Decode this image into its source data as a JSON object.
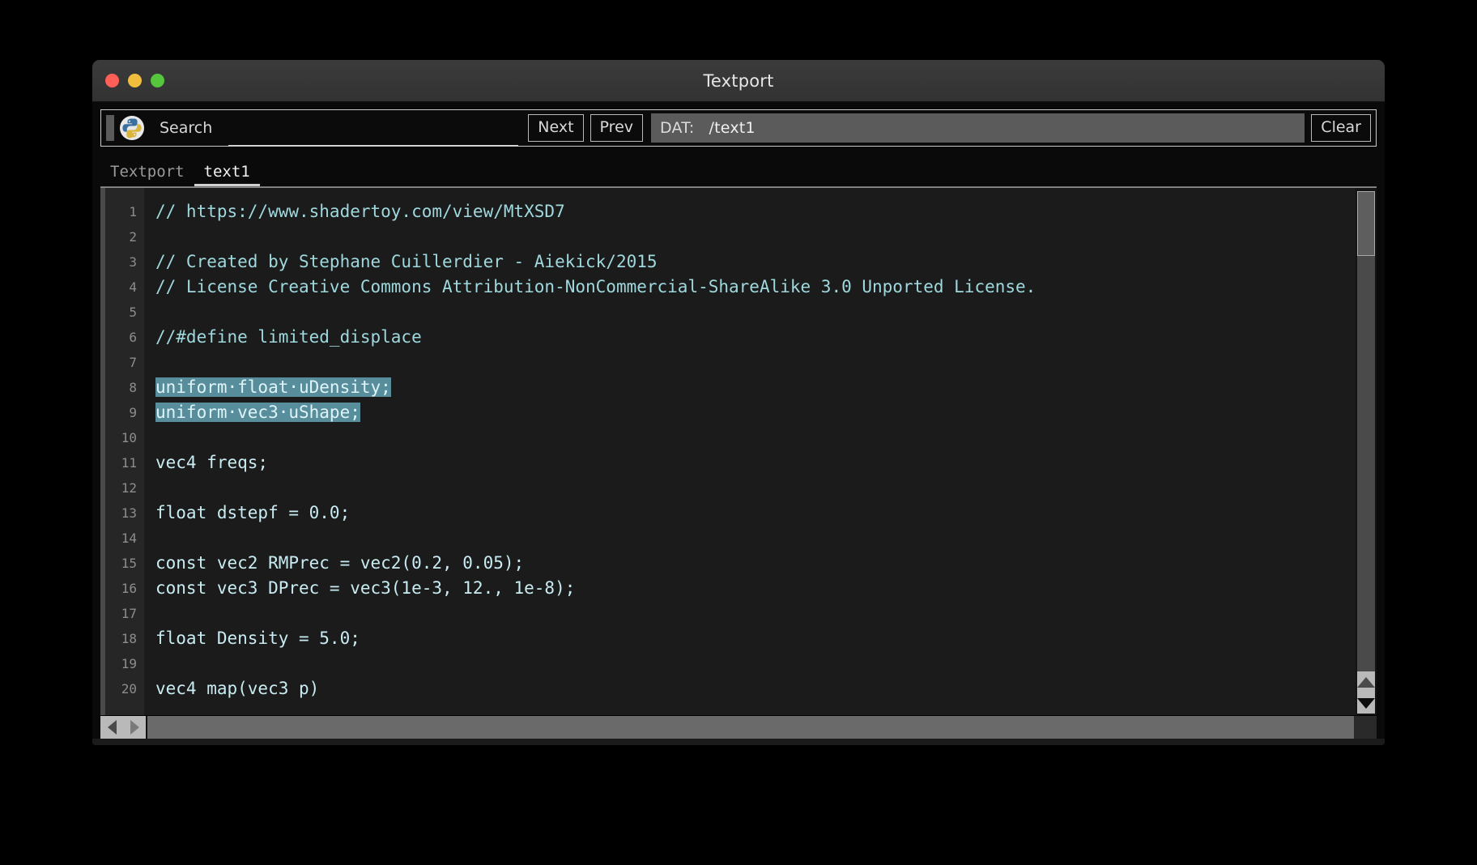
{
  "window": {
    "title": "Textport",
    "traffic_lights": [
      {
        "name": "close",
        "color": "#ff5f57"
      },
      {
        "name": "minimize",
        "color": "#f0bd3f"
      },
      {
        "name": "maximize",
        "color": "#56c73d"
      }
    ]
  },
  "toolbar": {
    "python_icon": "python-logo-icon",
    "search_label": "Search",
    "search_value": "",
    "search_placeholder": "",
    "next_label": "Next",
    "prev_label": "Prev",
    "dat_label": "DAT:",
    "dat_value": "/text1",
    "clear_label": "Clear"
  },
  "tabs": [
    {
      "label": "Textport",
      "active": false
    },
    {
      "label": "text1",
      "active": true
    }
  ],
  "editor": {
    "language": "glsl",
    "selection_color": "#588e9c",
    "comment_color": "#9fd8dd",
    "code_color": "#c8ecf2",
    "lines": [
      {
        "n": "1",
        "text": "// https://www.shadertoy.com/view/MtXSD7",
        "kind": "comment",
        "selected": false
      },
      {
        "n": "2",
        "text": "",
        "kind": "blank",
        "selected": false
      },
      {
        "n": "3",
        "text": "// Created by Stephane Cuillerdier - Aiekick/2015",
        "kind": "comment",
        "selected": false
      },
      {
        "n": "4",
        "text": "// License Creative Commons Attribution-NonCommercial-ShareAlike 3.0 Unported License.",
        "kind": "comment",
        "selected": false
      },
      {
        "n": "5",
        "text": "",
        "kind": "blank",
        "selected": false
      },
      {
        "n": "6",
        "text": "//#define limited_displace",
        "kind": "comment",
        "selected": false
      },
      {
        "n": "7",
        "text": "",
        "kind": "blank",
        "selected": false
      },
      {
        "n": "8",
        "text": "uniform float uDensity;",
        "kind": "code",
        "selected": true
      },
      {
        "n": "9",
        "text": "uniform vec3 uShape;",
        "kind": "code",
        "selected": true
      },
      {
        "n": "10",
        "text": "",
        "kind": "blank",
        "selected": false
      },
      {
        "n": "11",
        "text": "vec4 freqs;",
        "kind": "code",
        "selected": false
      },
      {
        "n": "12",
        "text": "",
        "kind": "blank",
        "selected": false
      },
      {
        "n": "13",
        "text": "float dstepf = 0.0;",
        "kind": "code",
        "selected": false
      },
      {
        "n": "14",
        "text": "",
        "kind": "blank",
        "selected": false
      },
      {
        "n": "15",
        "text": "const vec2 RMPrec = vec2(0.2, 0.05);",
        "kind": "code",
        "selected": false
      },
      {
        "n": "16",
        "text": "const vec3 DPrec = vec3(1e-3, 12., 1e-8);",
        "kind": "code",
        "selected": false
      },
      {
        "n": "17",
        "text": "",
        "kind": "blank",
        "selected": false
      },
      {
        "n": "18",
        "text": "float Density = 5.0;",
        "kind": "code",
        "selected": false
      },
      {
        "n": "19",
        "text": "",
        "kind": "blank",
        "selected": false
      },
      {
        "n": "20",
        "text": "vec4 map(vec3 p)",
        "kind": "code",
        "selected": false
      }
    ]
  },
  "scrollbars": {
    "vertical_up_icon": "triangle-up-icon",
    "vertical_down_icon": "triangle-down-icon",
    "horizontal_left_icon": "triangle-left-icon",
    "horizontal_right_icon": "triangle-right-icon"
  }
}
